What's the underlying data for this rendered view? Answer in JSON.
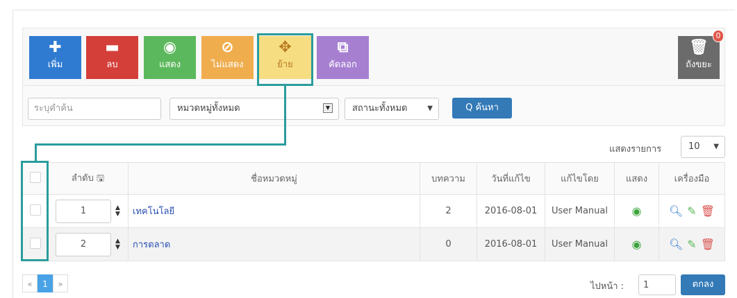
{
  "toolbar": {
    "add": {
      "icon": "✚",
      "label": "เพิ่ม"
    },
    "delete": {
      "icon": "▬",
      "label": "ลบ"
    },
    "show": {
      "icon": "◉",
      "label": "แสดง"
    },
    "hide": {
      "icon": "⊘",
      "label": "ไม่แสดง"
    },
    "move": {
      "icon": "✥",
      "label": "ย้าย"
    },
    "copy": {
      "icon": "⧉",
      "label": "คัดลอก"
    },
    "trash": {
      "icon": "🗑",
      "label": "ถังขยะ",
      "count": "0"
    }
  },
  "filters": {
    "keyword_placeholder": "ระบุคำค้น",
    "category": "หมวดหมู่ทั้งหมด",
    "status": "สถานะทั้งหมด",
    "search_label": "Q ค้นหา"
  },
  "perpage": {
    "label": "แสดงรายการ",
    "value": "10"
  },
  "table": {
    "headers": {
      "order": "ลำดับ 🖫",
      "name": "ชื่อหมวดหมู่",
      "articles": "บทความ",
      "modified": "วันที่แก้ไข",
      "editor": "แก้ไขโดย",
      "display": "แสดง",
      "tools": "เครื่องมือ"
    },
    "rows": [
      {
        "order": "1",
        "name": "เทคโนโลยี",
        "articles": "2",
        "modified": "2016-08-01",
        "editor": "User Manual"
      },
      {
        "order": "2",
        "name": "การตลาด",
        "articles": "0",
        "modified": "2016-08-01",
        "editor": "User Manual"
      }
    ]
  },
  "pagination": {
    "prev": "«",
    "current": "1",
    "next": "»"
  },
  "goto": {
    "label": "ไปหน้า :",
    "value": "1",
    "button": "ตกลง"
  },
  "colors": {
    "highlight": "#2a9c9c",
    "primary": "#337ab7"
  }
}
